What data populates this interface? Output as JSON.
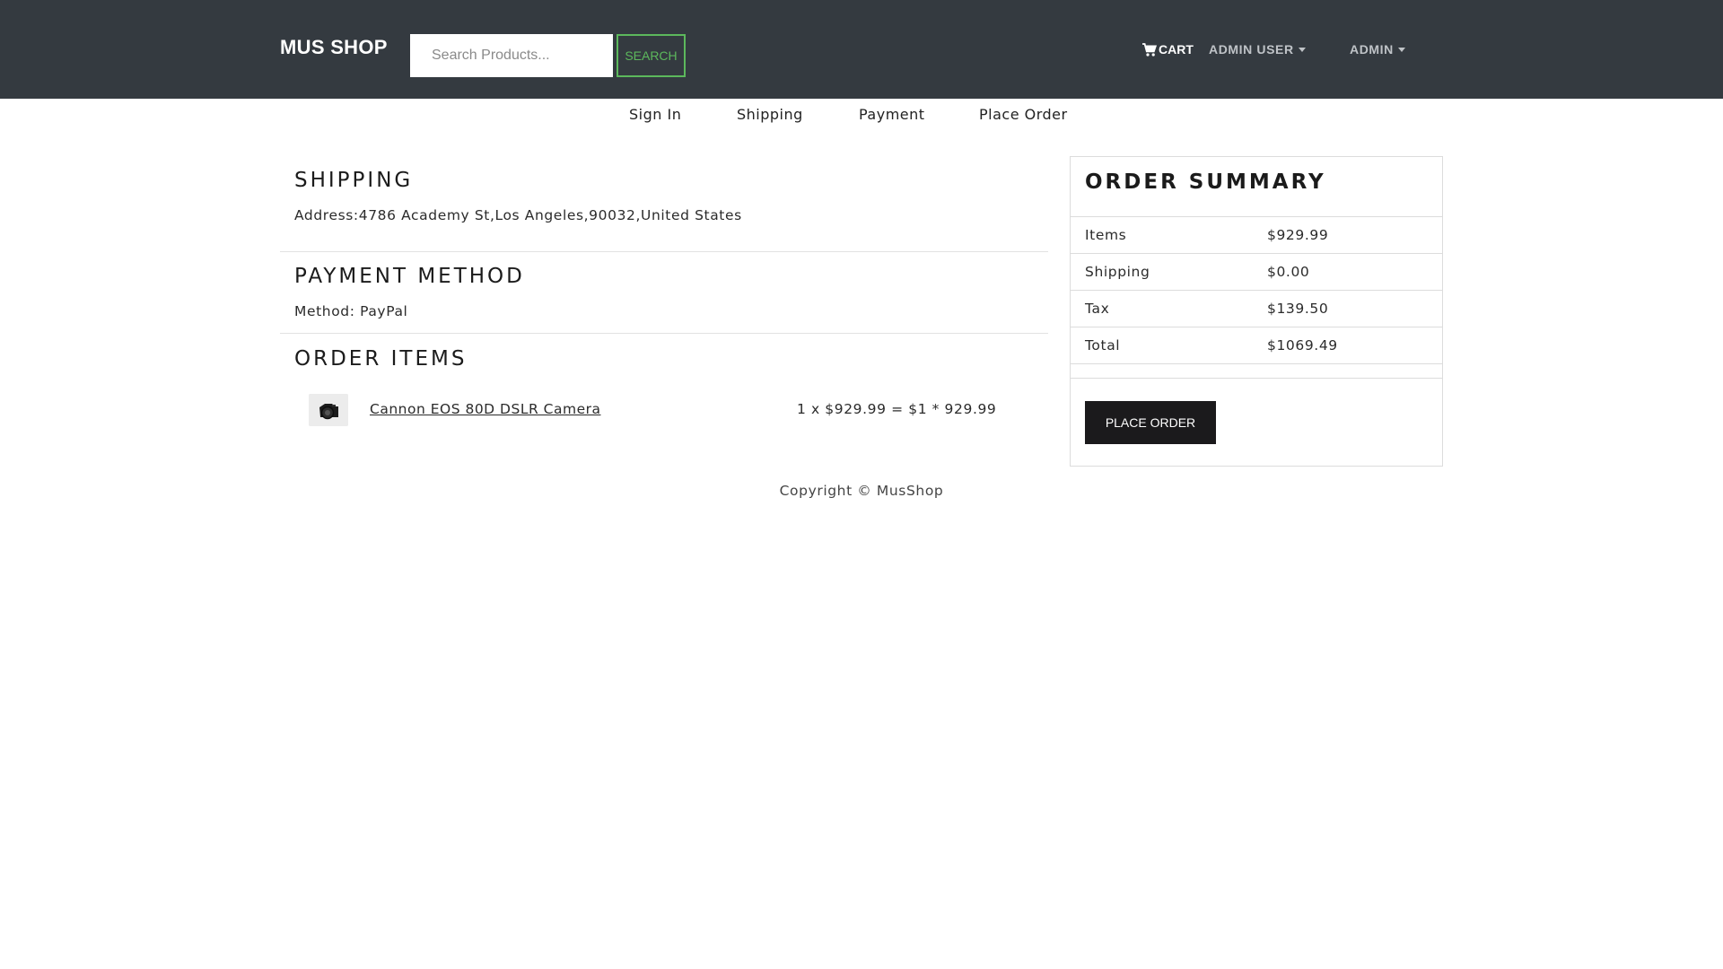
{
  "navbar": {
    "brand": "MUS SHOP",
    "search_placeholder": "Search Products...",
    "search_button": "SEARCH",
    "cart_label": "CART",
    "user_menu": "ADMIN USER",
    "admin_menu": "ADMIN"
  },
  "steps": [
    "Sign In",
    "Shipping",
    "Payment",
    "Place Order"
  ],
  "shipping": {
    "title": "SHIPPING",
    "address": "Address:4786 Academy St,Los Angeles,90032,United States"
  },
  "payment": {
    "title": "PAYMENT METHOD",
    "method": "Method: PayPal"
  },
  "order_items": {
    "title": "ORDER ITEMS",
    "items": [
      {
        "name": "Cannon EOS 80D DSLR Camera",
        "calc": "1 x $929.99 = $1 * 929.99"
      }
    ]
  },
  "summary": {
    "title": "ORDER SUMMARY",
    "rows": [
      {
        "label": "Items",
        "value": "$929.99"
      },
      {
        "label": "Shipping",
        "value": "$0.00"
      },
      {
        "label": "Tax",
        "value": "$139.50"
      },
      {
        "label": "Total",
        "value": "$1069.49"
      }
    ],
    "button": "PLACE ORDER"
  },
  "footer": "Copyright © MusShop",
  "colors": {
    "navbar_bg": "#343a40",
    "search_accent": "#5cb85c",
    "button_dark": "#1b1a1c"
  }
}
